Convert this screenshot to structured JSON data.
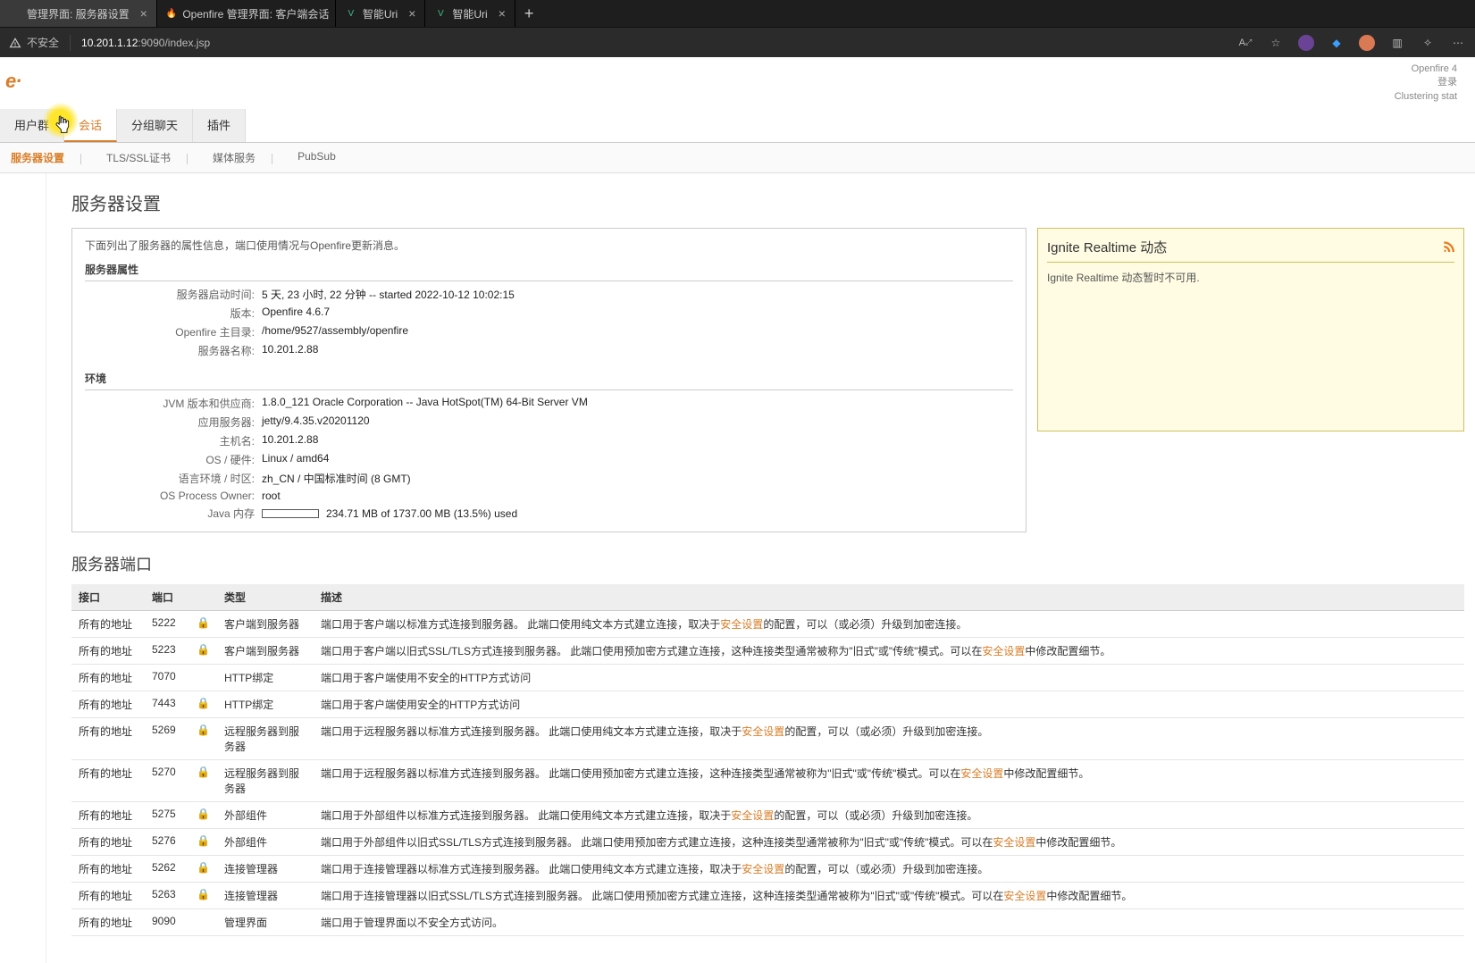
{
  "browser": {
    "tabs": [
      {
        "title": "管理界面: 服务器设置",
        "favicon": ""
      },
      {
        "title": "Openfire 管理界面: 客户端会话",
        "favicon": "🔥"
      },
      {
        "title": "智能Uri",
        "favicon": "V"
      },
      {
        "title": "智能Uri",
        "favicon": "V"
      }
    ],
    "insecure_label": "不安全",
    "url_host": "10.201.1.12",
    "url_rest": ":9090/index.jsp"
  },
  "top_info": {
    "line1": "Openfire 4",
    "line2": "登录",
    "line3": "Clustering stat"
  },
  "logo_text": "e·",
  "main_tabs": [
    "用户群",
    "会话",
    "分组聊天",
    "插件"
  ],
  "sub_tabs": [
    "服务器设置",
    "TLS/SSL证书",
    "媒体服务",
    "PubSub"
  ],
  "page_title": "服务器设置",
  "info": {
    "desc": "下面列出了服务器的属性信息，端口使用情况与Openfire更新消息。",
    "props_header": "服务器属性",
    "props": [
      {
        "label": "服务器启动时间:",
        "value": "5 天, 23 小时, 22 分钟 -- started 2022-10-12 10:02:15"
      },
      {
        "label": "版本:",
        "value": "Openfire 4.6.7"
      },
      {
        "label": "Openfire 主目录:",
        "value": "/home/9527/assembly/openfire"
      },
      {
        "label": "服务器名称:",
        "value": "10.201.2.88"
      }
    ],
    "env_header": "环境",
    "env": [
      {
        "label": "JVM 版本和供应商:",
        "value": "1.8.0_121 Oracle Corporation -- Java HotSpot(TM) 64-Bit Server VM"
      },
      {
        "label": "应用服务器:",
        "value": "jetty/9.4.35.v20201120"
      },
      {
        "label": "主机名:",
        "value": "10.201.2.88"
      },
      {
        "label": "OS / 硬件:",
        "value": "Linux / amd64"
      },
      {
        "label": "语言环境 / 时区:",
        "value": "zh_CN / 中国标准时间 (8 GMT)"
      },
      {
        "label": "OS Process Owner:",
        "value": "root"
      }
    ],
    "mem_label": "Java 内存",
    "mem_text": "234.71 MB of 1737.00 MB (13.5%) used",
    "mem_pct": 13.5
  },
  "ignite": {
    "title": "Ignite Realtime 动态",
    "body": "Ignite Realtime 动态暂时不可用."
  },
  "ports": {
    "title": "服务器端口",
    "headers": [
      "接口",
      "端口",
      "",
      "类型",
      "描述"
    ],
    "rows": [
      {
        "iface": "所有的地址",
        "port": "5222",
        "lock": true,
        "type": "客户端到服务器",
        "desc_pre": "端口用于客户端以标准方式连接到服务器。 此端口使用纯文本方式建立连接，取决于",
        "link": "安全设置",
        "desc_post": "的配置，可以（或必须）升级到加密连接。"
      },
      {
        "iface": "所有的地址",
        "port": "5223",
        "lock": true,
        "type": "客户端到服务器",
        "desc_pre": "端口用于客户端以旧式SSL/TLS方式连接到服务器。 此端口使用预加密方式建立连接，这种连接类型通常被称为\"旧式\"或\"传统\"模式。可以在",
        "link": "安全设置",
        "desc_post": "中修改配置细节。"
      },
      {
        "iface": "所有的地址",
        "port": "7070",
        "lock": false,
        "type": "HTTP绑定",
        "desc_pre": "端口用于客户端使用不安全的HTTP方式访问",
        "link": "",
        "desc_post": ""
      },
      {
        "iface": "所有的地址",
        "port": "7443",
        "lock": true,
        "type": "HTTP绑定",
        "desc_pre": "端口用于客户端使用安全的HTTP方式访问",
        "link": "",
        "desc_post": ""
      },
      {
        "iface": "所有的地址",
        "port": "5269",
        "lock": true,
        "type": "远程服务器到服务器",
        "desc_pre": "端口用于远程服务器以标准方式连接到服务器。 此端口使用纯文本方式建立连接，取决于",
        "link": "安全设置",
        "desc_post": "的配置，可以（或必须）升级到加密连接。"
      },
      {
        "iface": "所有的地址",
        "port": "5270",
        "lock": true,
        "type": "远程服务器到服务器",
        "desc_pre": "端口用于远程服务器以标准方式连接到服务器。 此端口使用预加密方式建立连接，这种连接类型通常被称为\"旧式\"或\"传统\"模式。可以在",
        "link": "安全设置",
        "desc_post": "中修改配置细节。"
      },
      {
        "iface": "所有的地址",
        "port": "5275",
        "lock": true,
        "type": "外部组件",
        "desc_pre": "端口用于外部组件以标准方式连接到服务器。 此端口使用纯文本方式建立连接，取决于",
        "link": "安全设置",
        "desc_post": "的配置，可以（或必须）升级到加密连接。"
      },
      {
        "iface": "所有的地址",
        "port": "5276",
        "lock": true,
        "type": "外部组件",
        "desc_pre": "端口用于外部组件以旧式SSL/TLS方式连接到服务器。 此端口使用预加密方式建立连接，这种连接类型通常被称为\"旧式\"或\"传统\"模式。可以在",
        "link": "安全设置",
        "desc_post": "中修改配置细节。"
      },
      {
        "iface": "所有的地址",
        "port": "5262",
        "lock": true,
        "type": "连接管理器",
        "desc_pre": "端口用于连接管理器以标准方式连接到服务器。 此端口使用纯文本方式建立连接，取决于",
        "link": "安全设置",
        "desc_post": "的配置，可以（或必须）升级到加密连接。"
      },
      {
        "iface": "所有的地址",
        "port": "5263",
        "lock": true,
        "type": "连接管理器",
        "desc_pre": "端口用于连接管理器以旧式SSL/TLS方式连接到服务器。 此端口使用预加密方式建立连接，这种连接类型通常被称为\"旧式\"或\"传统\"模式。可以在",
        "link": "安全设置",
        "desc_post": "中修改配置细节。"
      },
      {
        "iface": "所有的地址",
        "port": "9090",
        "lock": false,
        "type": "管理界面",
        "desc_pre": "端口用于管理界面以不安全方式访问。",
        "link": "",
        "desc_post": ""
      }
    ]
  }
}
